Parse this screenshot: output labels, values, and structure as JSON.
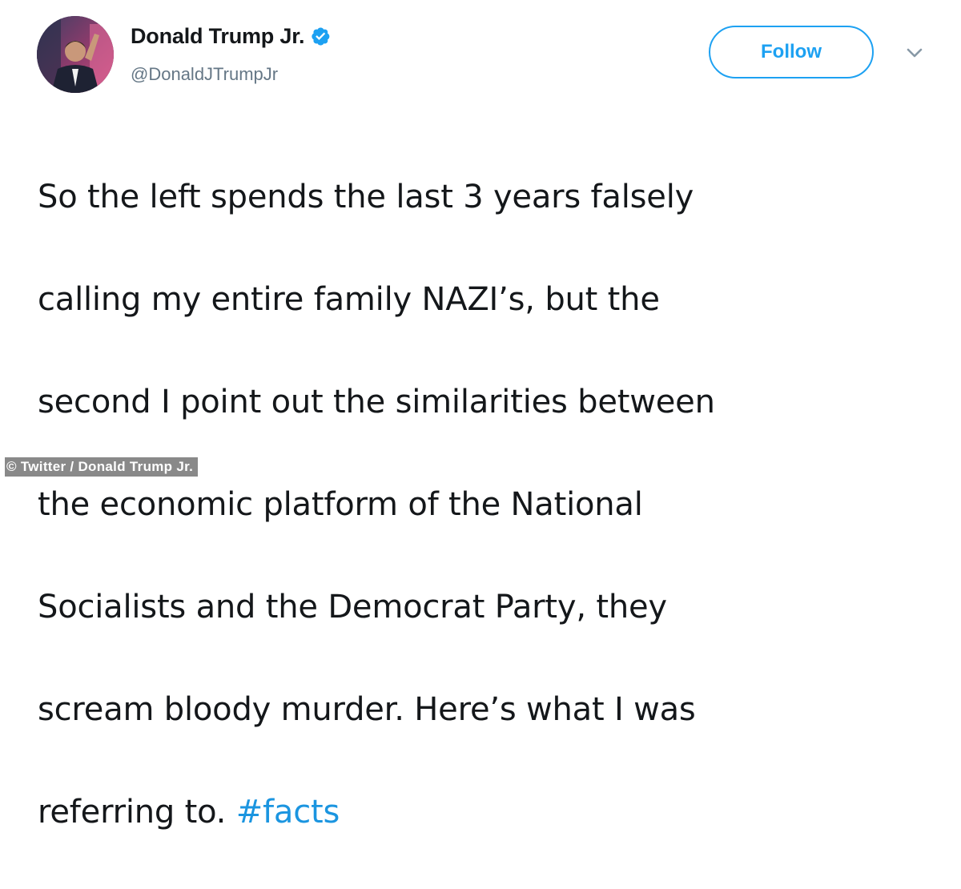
{
  "user": {
    "display_name": "Donald Trump Jr.",
    "handle": "@DonaldJTrumpJr",
    "verified": true
  },
  "actions": {
    "follow_label": "Follow"
  },
  "tweet": {
    "lines": [
      "So the left spends the last 3 years falsely",
      "calling my entire family NAZI’s, but the",
      "second I point out the similarities between",
      "the economic platform of the National",
      "Socialists and the Democrat Party, they",
      "scream bloody murder. Here’s what I was",
      "referring to. "
    ],
    "hashtag": "#facts"
  },
  "watermark": "© Twitter / Donald Trump Jr.",
  "colors": {
    "accent": "#1da1f2",
    "hashtag": "#1b95e0",
    "text": "#14171a",
    "secondary": "#657786"
  },
  "icons": {
    "verified": "verified-badge-icon",
    "menu": "chevron-down-icon"
  }
}
